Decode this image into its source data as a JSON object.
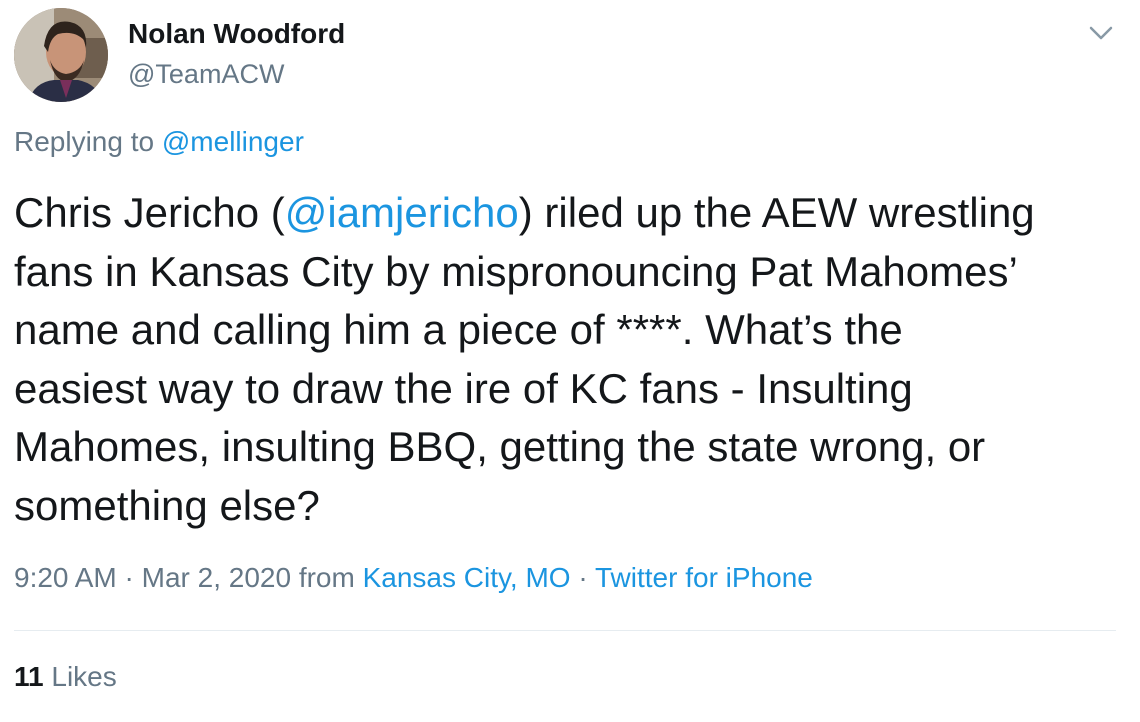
{
  "user": {
    "name": "Nolan Woodford",
    "handle": "@TeamACW"
  },
  "reply": {
    "prefix": "Replying to ",
    "handle": "@mellinger"
  },
  "tweet": {
    "line1_a": "Chris Jericho (",
    "mention": "@iamjericho",
    "line1_b": ") riled up the AEW wrestling",
    "line2": "fans in Kansas City by mispronouncing Pat Mahomes’",
    "line3": "name and calling him a piece of ****.  What’s the",
    "line4": "easiest way to draw the ire of KC fans - Insulting",
    "line5": "Mahomes, insulting BBQ, getting the state wrong, or",
    "line6": "something else?"
  },
  "meta": {
    "time": "9:20 AM",
    "sep1": " · ",
    "date": "Mar 2, 2020",
    "from": " from ",
    "location": "Kansas City, MO",
    "sep2": " · ",
    "source": "Twitter for iPhone"
  },
  "likes": {
    "count": "11",
    "label": " Likes"
  },
  "icons": {
    "menu": "chevron-down-icon"
  },
  "colors": {
    "link": "#1b95e0",
    "secondary": "#657786",
    "text": "#14171a",
    "divider": "#e6ecf0"
  }
}
